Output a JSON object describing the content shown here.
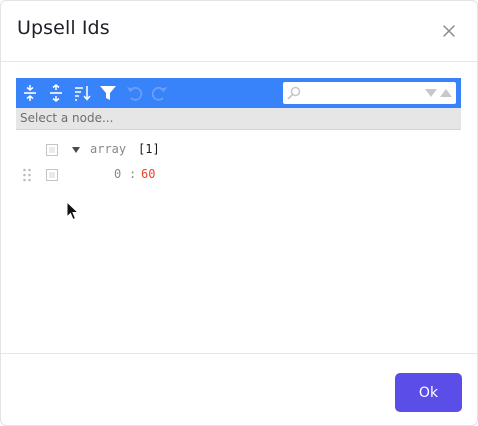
{
  "modal": {
    "title": "Upsell Ids",
    "close_glyph": "×"
  },
  "toolbar": {
    "buttons": [
      {
        "icon": "expand-all-icon"
      },
      {
        "icon": "collapse-all-icon"
      },
      {
        "icon": "sort-icon"
      },
      {
        "icon": "filter-icon"
      },
      {
        "icon": "undo-icon"
      },
      {
        "icon": "redo-icon"
      }
    ],
    "search": {
      "value": "",
      "placeholder": ""
    }
  },
  "navbar": {
    "text": "Select a node..."
  },
  "tree": {
    "root": {
      "field": "array",
      "count": "[1]",
      "expanded": true
    },
    "items": [
      {
        "field": "0",
        "separator": ":",
        "value": "60"
      }
    ]
  },
  "footer": {
    "ok_label": "Ok"
  },
  "colors": {
    "toolbar": "#3883fa",
    "primary_button": "#5b4ee8",
    "value_number": "#ee422e",
    "navbar": "#e6e6e6"
  }
}
